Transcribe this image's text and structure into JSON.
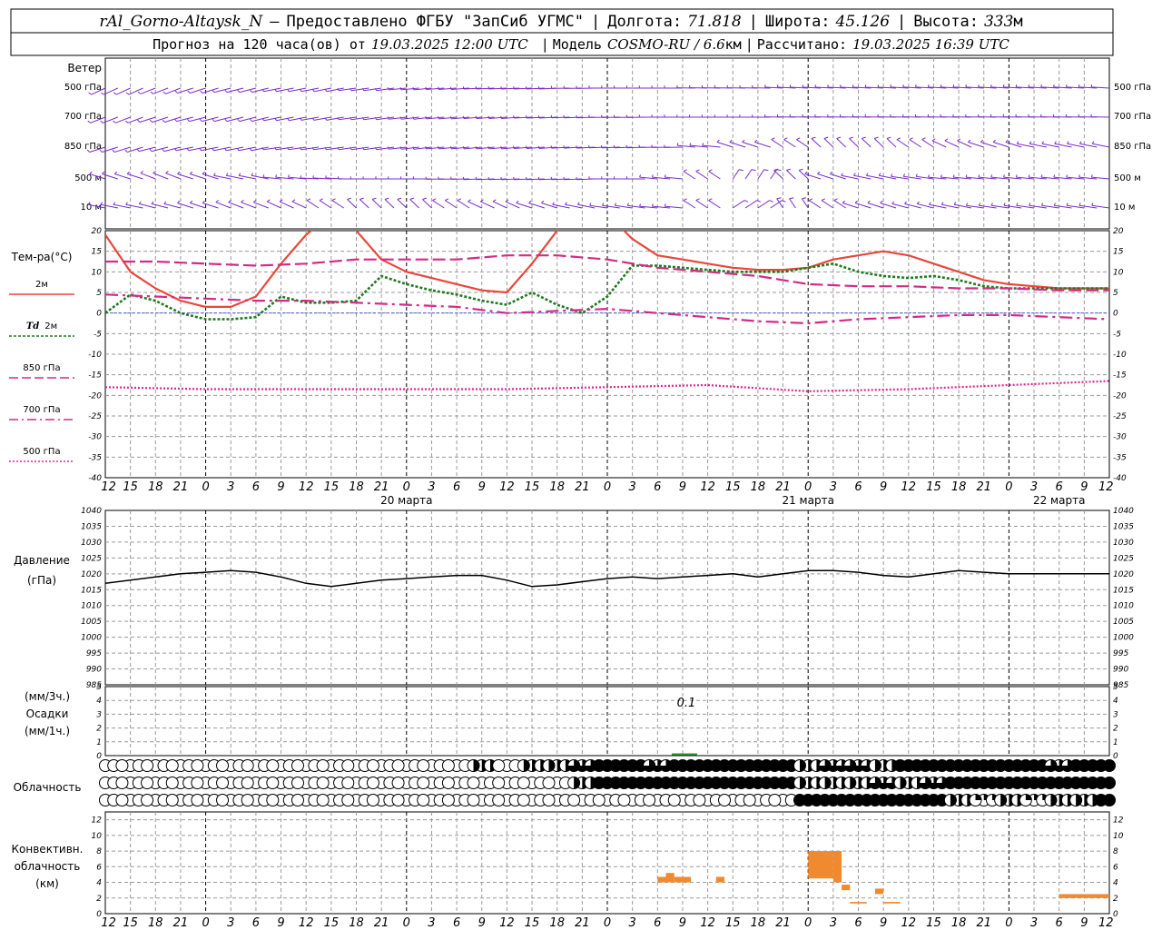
{
  "header": {
    "station": "rAl_Gorno-Altaysk_N",
    "dash": "—",
    "provided": "Предоставлено ФГБУ \"ЗапСиб УГМС\"",
    "sep": "|",
    "lon_label": "Долгота:",
    "lon_value": "71.818",
    "lat_label": "Широта:",
    "lat_value": "45.126",
    "alt_label": "Высота:",
    "alt_value": "333",
    "alt_unit": "м",
    "forecast_prefix": "Прогноз на 120 часа(ов) от",
    "forecast_time": "19.03.2025 12:00 UTC",
    "model_label": "Модель",
    "model_value": "COSMO-RU / 6.6",
    "model_unit": "км",
    "calc_label": "Рассчитано:",
    "calc_value": "19.03.2025 16:39 UTC"
  },
  "panels": {
    "wind": {
      "title": "Ветер",
      "levels": [
        "500 гПа",
        "700 гПа",
        "850 гПа",
        "500 м",
        "10 м"
      ]
    },
    "temperature": {
      "title": "Тем-ра(°C)",
      "legend": [
        {
          "label": "2м",
          "italic_prefix": ""
        },
        {
          "label": "2м",
          "italic_prefix": "Td"
        },
        {
          "label": "850 гПа",
          "italic_prefix": ""
        },
        {
          "label": "700 гПа",
          "italic_prefix": ""
        },
        {
          "label": "500 гПа",
          "italic_prefix": ""
        }
      ]
    },
    "pressure": {
      "title": "Давление",
      "unit": "(гПа)"
    },
    "precip": {
      "unit1": "(мм/3ч.)",
      "title": "Осадки",
      "unit2": "(мм/1ч.)",
      "annotation": "0.1"
    },
    "clouds": {
      "title": "Облачность"
    },
    "convective": {
      "title1": "Конвективн.",
      "title2": "облачность",
      "unit": "(км)"
    }
  },
  "colors": {
    "wind": "#7b2fc9",
    "t2m": "#e8473b",
    "td2m": "#1f7a1f",
    "t850": "#d42a86",
    "t700": "#d42a86",
    "t500": "#e0258f",
    "pressure": "#000000",
    "precip": "#2ca02c",
    "convective": "#f08a30",
    "zero_line": "#4a5fd9"
  },
  "chart_data": [
    {
      "type": "line",
      "title": "Тем-ра(°C)",
      "x_tick_labels": [
        "12",
        "15",
        "18",
        "21",
        "0",
        "3",
        "6",
        "9",
        "12",
        "15",
        "18",
        "21",
        "0",
        "3",
        "6",
        "9",
        "12",
        "15",
        "18",
        "21",
        "0",
        "3",
        "6",
        "9",
        "12",
        "15",
        "18"
      ],
      "date_labels": [
        "20 марта",
        "21 марта",
        "22 марта"
      ],
      "x_unit": "hours since 19.03.2025 12:00 UTC",
      "ylim": [
        -40,
        20
      ],
      "y_ticks": [
        20,
        15,
        10,
        5,
        0,
        -5,
        -10,
        -15,
        -20,
        -25,
        -30,
        -35,
        -40
      ],
      "grid": true,
      "series": [
        {
          "name": "2м",
          "style": "solid",
          "x": [
            0,
            3,
            6,
            9,
            12,
            15,
            18,
            21,
            24,
            27,
            30,
            33,
            36,
            39,
            42,
            45,
            48,
            51,
            54,
            57,
            60,
            63,
            66,
            69,
            72,
            75,
            78,
            81,
            84,
            87,
            90,
            93,
            96,
            99,
            102,
            105,
            108,
            111,
            114,
            117,
            120
          ],
          "y": [
            19,
            10,
            6,
            3,
            1.5,
            1.5,
            4,
            12,
            19,
            24,
            20,
            13,
            10,
            8.5,
            7,
            5.5,
            5,
            12,
            20,
            26,
            24,
            18,
            14,
            13,
            12,
            11,
            10.5,
            10.5,
            11,
            13,
            14,
            15,
            14,
            12,
            10,
            8,
            7,
            6.5,
            6,
            6,
            6
          ]
        },
        {
          "name": "Td 2м",
          "style": "dotted",
          "x": [
            0,
            3,
            6,
            9,
            12,
            15,
            18,
            21,
            24,
            27,
            30,
            33,
            36,
            39,
            42,
            45,
            48,
            51,
            54,
            57,
            60,
            63,
            66,
            69,
            72,
            75,
            78,
            81,
            84,
            87,
            90,
            93,
            96,
            99,
            102,
            105,
            108,
            111,
            114,
            117,
            120
          ],
          "y": [
            0,
            4.5,
            3,
            0,
            -1.5,
            -1.5,
            -1,
            4,
            2.5,
            2.5,
            3,
            9,
            7,
            5.5,
            4.5,
            3,
            2,
            5,
            2,
            0,
            4,
            11.5,
            11.5,
            11,
            10.5,
            10,
            10,
            10,
            11,
            12,
            10,
            9,
            8.5,
            9,
            8,
            6.5,
            6,
            6,
            6,
            6,
            6
          ]
        },
        {
          "name": "850 гПа",
          "style": "dashed",
          "x": [
            0,
            6,
            12,
            18,
            24,
            30,
            36,
            42,
            48,
            54,
            60,
            66,
            72,
            78,
            84,
            90,
            96,
            102,
            108,
            114,
            120
          ],
          "y": [
            12.5,
            12.5,
            12,
            11.5,
            12,
            13,
            13,
            13,
            14,
            14,
            13,
            11,
            10,
            9,
            7,
            6.5,
            6.5,
            6,
            6,
            5.5,
            5.5
          ]
        },
        {
          "name": "700 гПа",
          "style": "dashdot",
          "x": [
            0,
            6,
            12,
            18,
            24,
            30,
            36,
            42,
            48,
            54,
            60,
            66,
            72,
            78,
            84,
            90,
            96,
            102,
            108,
            114,
            120
          ],
          "y": [
            4.5,
            4,
            3.5,
            3,
            3,
            2.5,
            2,
            1.5,
            0,
            0.5,
            1,
            0,
            -1,
            -2,
            -2.5,
            -1.5,
            -1,
            -0.5,
            -0.5,
            -1,
            -1.5
          ]
        },
        {
          "name": "500 гПа",
          "style": "fine-dotted",
          "x": [
            0,
            12,
            24,
            36,
            48,
            60,
            72,
            84,
            96,
            108,
            120
          ],
          "y": [
            -18,
            -18.5,
            -18.5,
            -18.5,
            -18.5,
            -18,
            -17.5,
            -19,
            -18.5,
            -17.5,
            -16.5
          ]
        }
      ]
    },
    {
      "type": "line",
      "title": "Давление",
      "ylabel": "(гПа)",
      "ylim": [
        985,
        1040
      ],
      "y_ticks": [
        1040,
        1035,
        1030,
        1025,
        1020,
        1015,
        1010,
        1005,
        1000,
        995,
        990,
        985
      ],
      "grid": true,
      "series": [
        {
          "name": "Давление",
          "x": [
            0,
            3,
            6,
            9,
            12,
            15,
            18,
            21,
            24,
            27,
            30,
            33,
            36,
            39,
            42,
            45,
            48,
            51,
            54,
            57,
            60,
            63,
            66,
            69,
            72,
            75,
            78,
            81,
            84,
            87,
            90,
            93,
            96,
            99,
            102,
            105,
            108,
            111,
            114,
            117,
            120
          ],
          "y": [
            1017,
            1018,
            1019,
            1020,
            1020.5,
            1021,
            1020.5,
            1019,
            1017,
            1016,
            1017,
            1018,
            1018.5,
            1019,
            1019.5,
            1019.5,
            1018,
            1016,
            1016.5,
            1017.5,
            1018.5,
            1019,
            1018.5,
            1019,
            1019.5,
            1020,
            1019,
            1020,
            1021,
            1021,
            1020.5,
            1019.5,
            1019,
            1020,
            1021,
            1020.5,
            1020,
            1020,
            1020,
            1020,
            1020
          ]
        }
      ]
    },
    {
      "type": "bar",
      "title": "Осадки",
      "ylim": [
        0,
        5
      ],
      "y_ticks": [
        5,
        4,
        3,
        2,
        1,
        0
      ],
      "bars": [
        {
          "x": 69,
          "value": 0.1,
          "label": "0.1"
        }
      ]
    },
    {
      "type": "table",
      "title": "Облачность",
      "rows": [
        {
          "name": "upper",
          "x": [
            0,
            3,
            6,
            9,
            12,
            15,
            18,
            21,
            24,
            27,
            30,
            33,
            36,
            39,
            42,
            45,
            48,
            51,
            54,
            57,
            60,
            63,
            66,
            69,
            72,
            75,
            78,
            81,
            84,
            87,
            90,
            93,
            96,
            99,
            102,
            105,
            108,
            111,
            114,
            117,
            120
          ],
          "cover": [
            0,
            0,
            0,
            0,
            0,
            0,
            0,
            0,
            0,
            0,
            0,
            0,
            0,
            0,
            0,
            0.5,
            0,
            0.5,
            0.5,
            0.75,
            1,
            1,
            0.75,
            1,
            1,
            1,
            1,
            1,
            0.5,
            0.75,
            0.75,
            0.5,
            1,
            1,
            1,
            1,
            1,
            1,
            0.75,
            1,
            1
          ]
        },
        {
          "name": "middle",
          "x": [
            0,
            3,
            6,
            9,
            12,
            15,
            18,
            21,
            24,
            27,
            30,
            33,
            36,
            39,
            42,
            45,
            48,
            51,
            54,
            57,
            60,
            63,
            66,
            69,
            72,
            75,
            78,
            81,
            84,
            87,
            90,
            93,
            96,
            99,
            102,
            105,
            108,
            111,
            114,
            117,
            120
          ],
          "cover": [
            0,
            0,
            0,
            0,
            0,
            0,
            0,
            0,
            0,
            0,
            0,
            0,
            0,
            0,
            0,
            0,
            0,
            0,
            0,
            0.5,
            1,
            1,
            1,
            1,
            1,
            1,
            1,
            1,
            0.5,
            0.5,
            0.5,
            0.75,
            0.5,
            0.75,
            1,
            1,
            1,
            1,
            1,
            1,
            1
          ]
        },
        {
          "name": "lower",
          "x": [
            0,
            3,
            6,
            9,
            12,
            15,
            18,
            21,
            24,
            27,
            30,
            33,
            36,
            39,
            42,
            45,
            48,
            51,
            54,
            57,
            60,
            63,
            66,
            69,
            72,
            75,
            78,
            81,
            84,
            87,
            90,
            93,
            96,
            99,
            102,
            105,
            108,
            111,
            114,
            117,
            120
          ],
          "cover": [
            0,
            0,
            0,
            0,
            0,
            0,
            0,
            0,
            0,
            0,
            0,
            0,
            0,
            0,
            0,
            0,
            0,
            0,
            0,
            0,
            0,
            0,
            0,
            0,
            0,
            0,
            0,
            0,
            1,
            1,
            1,
            1,
            1,
            1,
            0.5,
            0.25,
            0.5,
            0.25,
            0.5,
            0.5,
            1
          ]
        }
      ]
    },
    {
      "type": "bar",
      "title": "Конвективн. облачность",
      "ylabel": "(км)",
      "ylim": [
        0,
        13
      ],
      "y_ticks": [
        12,
        10,
        8,
        6,
        4,
        2,
        0
      ],
      "bars": [
        {
          "x0": 66,
          "x1": 67,
          "bottom": 4,
          "top": 4.7
        },
        {
          "x0": 67,
          "x1": 68,
          "bottom": 4,
          "top": 5.2
        },
        {
          "x0": 68,
          "x1": 70,
          "bottom": 4,
          "top": 4.7
        },
        {
          "x0": 73,
          "x1": 74,
          "bottom": 4,
          "top": 4.7
        },
        {
          "x0": 84,
          "x1": 87,
          "bottom": 4.5,
          "top": 8
        },
        {
          "x0": 87,
          "x1": 88,
          "bottom": 4,
          "top": 8
        },
        {
          "x0": 88,
          "x1": 89,
          "bottom": 3,
          "top": 3.7
        },
        {
          "x0": 89,
          "x1": 91,
          "bottom": 1.3,
          "top": 1.5
        },
        {
          "x0": 92,
          "x1": 93,
          "bottom": 2.5,
          "top": 3.2
        },
        {
          "x0": 93,
          "x1": 95,
          "bottom": 1.3,
          "top": 1.5
        },
        {
          "x0": 114,
          "x1": 120,
          "bottom": 2,
          "top": 2.5
        }
      ]
    }
  ]
}
